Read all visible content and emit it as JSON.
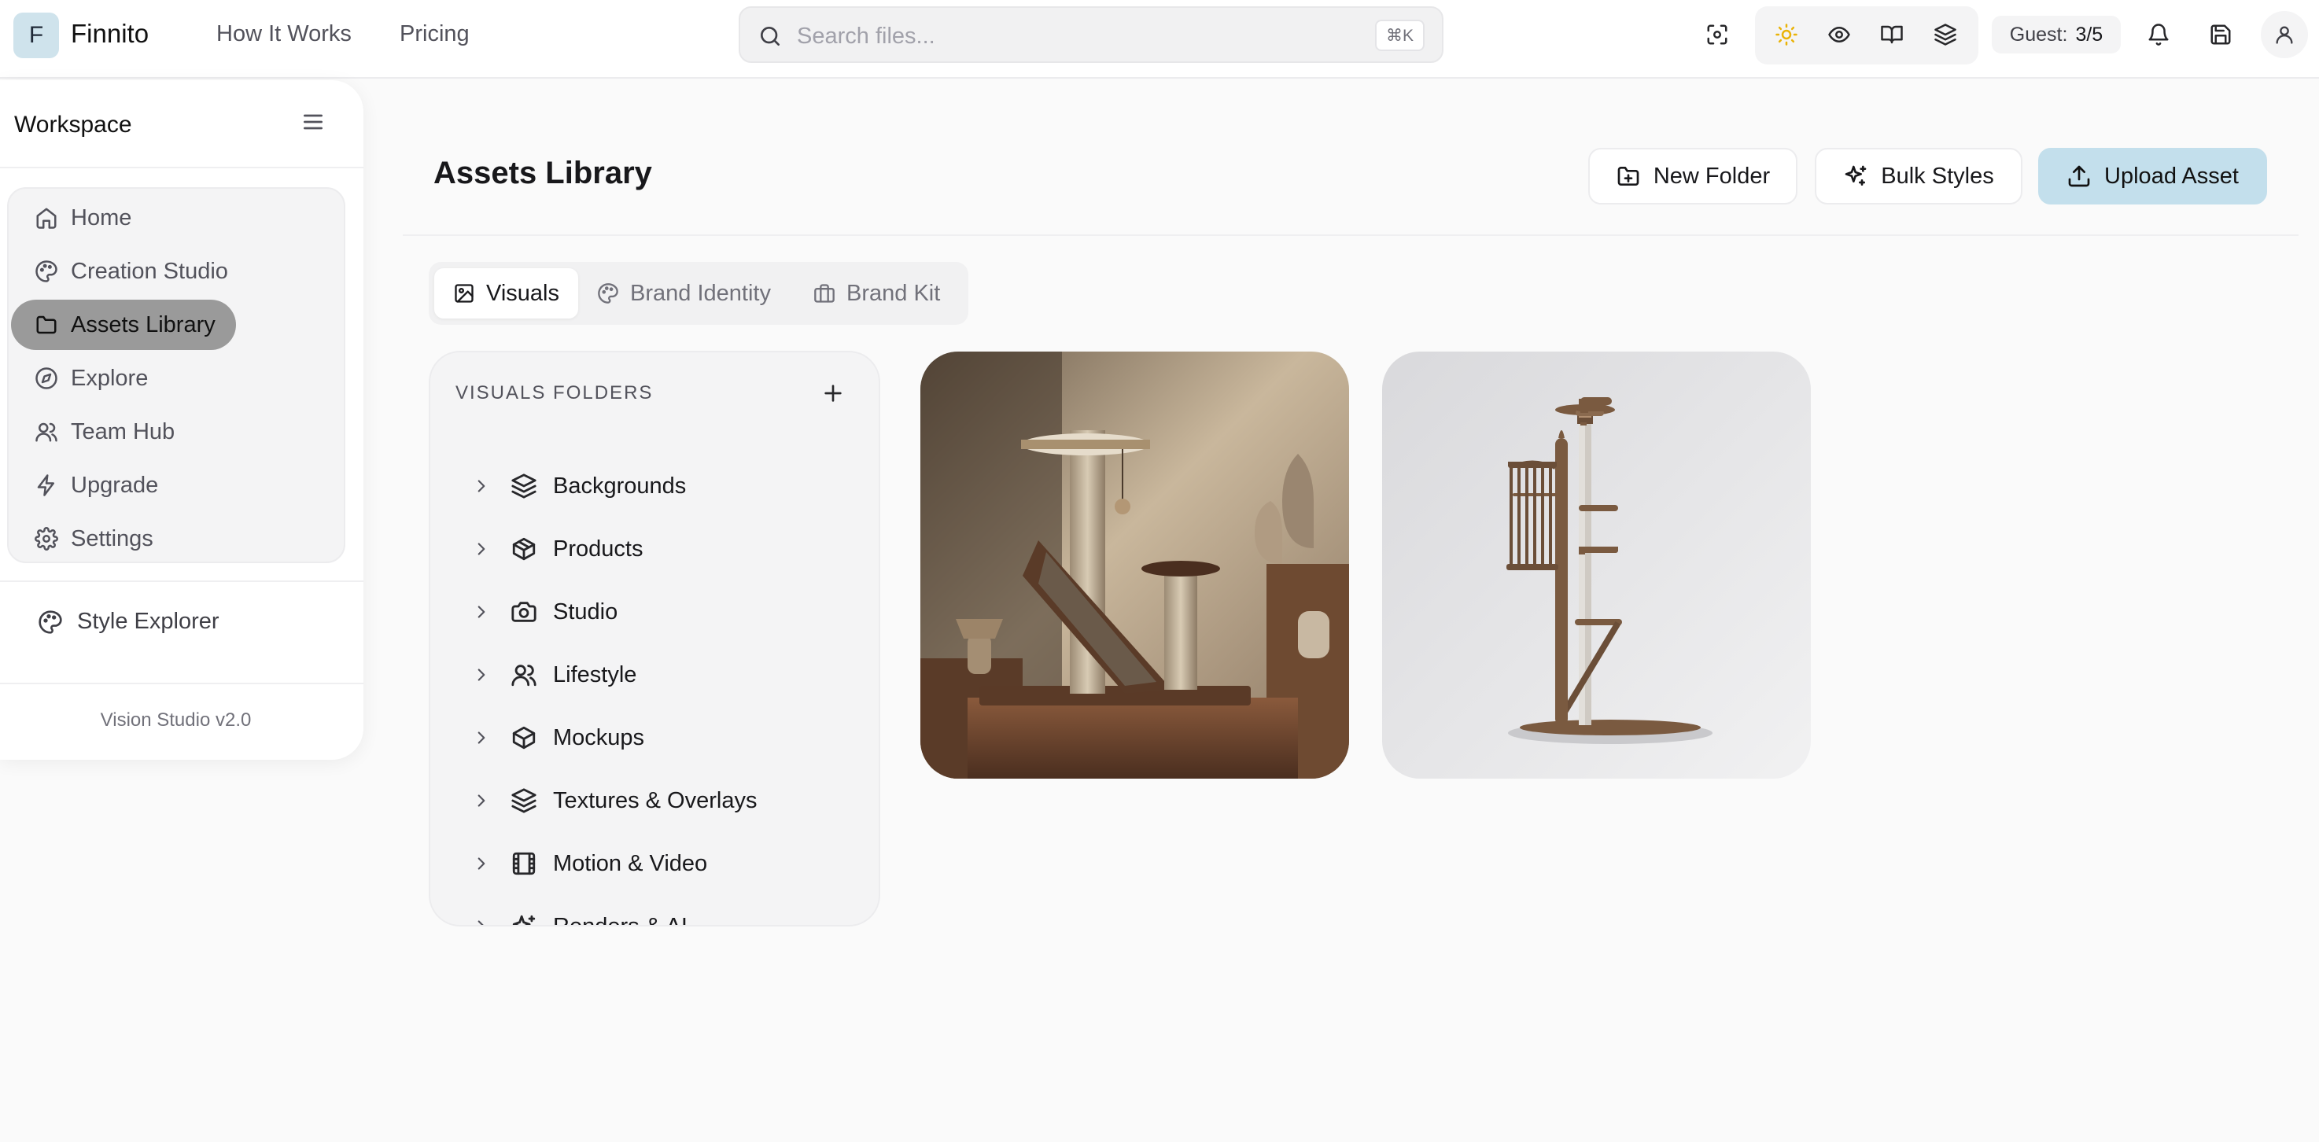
{
  "header": {
    "logo_letter": "F",
    "app_name": "Finnito",
    "nav": [
      "How It Works",
      "Pricing"
    ],
    "search": {
      "placeholder": "Search files...",
      "shortcut": "⌘K"
    },
    "tools": [
      "focus-icon",
      "sun-icon",
      "eye-icon",
      "book-open-icon",
      "layers-icon"
    ],
    "guest": {
      "label": "Guest:",
      "value": "3/5"
    },
    "actions": [
      "bell-icon",
      "save-icon",
      "user-icon"
    ]
  },
  "sidebar": {
    "title": "Workspace",
    "items": [
      {
        "label": "Home",
        "icon": "home-icon"
      },
      {
        "label": "Creation Studio",
        "icon": "palette-icon"
      },
      {
        "label": "Assets Library",
        "icon": "folder-icon",
        "active": true
      },
      {
        "label": "Explore",
        "icon": "compass-icon"
      },
      {
        "label": "Team Hub",
        "icon": "users-icon"
      },
      {
        "label": "Upgrade",
        "icon": "zap-icon"
      },
      {
        "label": "Settings",
        "icon": "gear-icon"
      }
    ],
    "style_explorer": "Style Explorer",
    "version": "Vision Studio v2.0"
  },
  "main": {
    "title": "Assets Library",
    "buttons": {
      "new_folder": "New Folder",
      "bulk_styles": "Bulk Styles",
      "upload": "Upload Asset"
    },
    "tabs": [
      {
        "label": "Visuals",
        "active": true
      },
      {
        "label": "Brand Identity"
      },
      {
        "label": "Brand Kit"
      }
    ],
    "folders": {
      "title": "VISUALS FOLDERS",
      "items": [
        {
          "label": "Backgrounds",
          "icon": "layers-icon"
        },
        {
          "label": "Products",
          "icon": "package-icon"
        },
        {
          "label": "Studio",
          "icon": "camera-icon"
        },
        {
          "label": "Lifestyle",
          "icon": "users-icon"
        },
        {
          "label": "Mockups",
          "icon": "package-icon"
        },
        {
          "label": "Textures & Overlays",
          "icon": "layers-icon"
        },
        {
          "label": "Motion & Video",
          "icon": "film-icon"
        },
        {
          "label": "Renders & AI",
          "icon": "sparkles-icon"
        }
      ]
    }
  },
  "colors": {
    "accent": "#c3dfec",
    "active_nav": "#9a9a9a",
    "background": "#fafafa"
  }
}
